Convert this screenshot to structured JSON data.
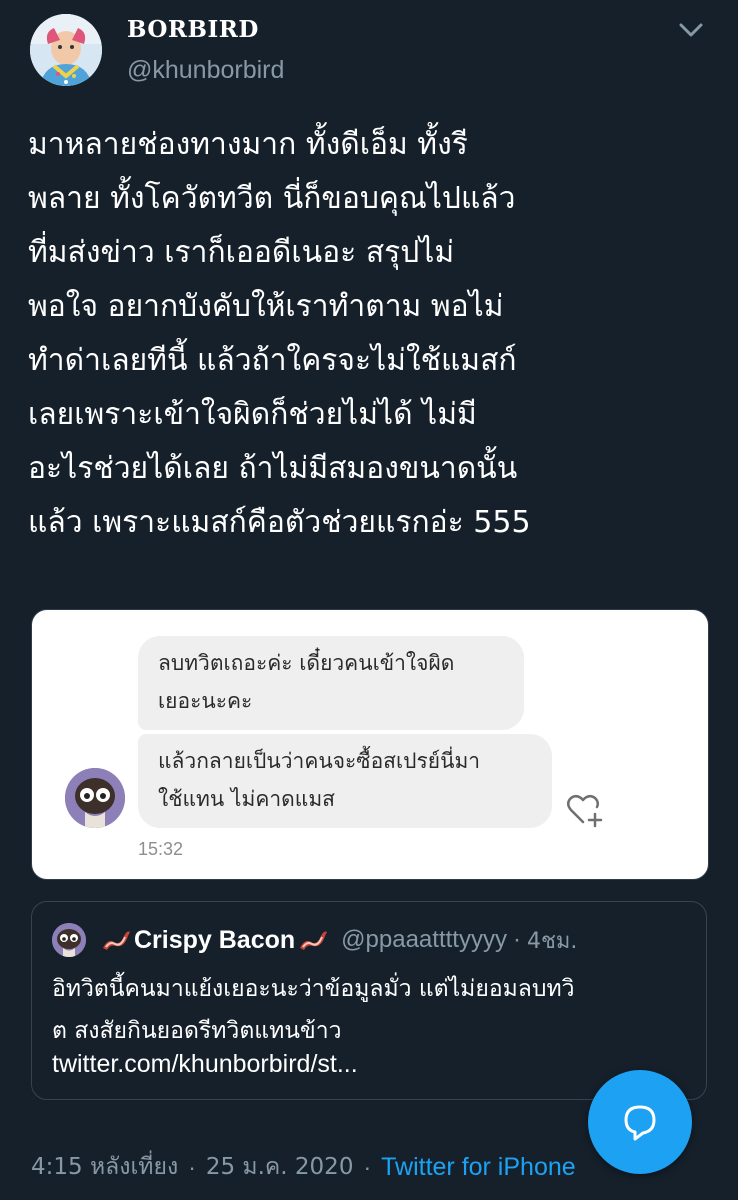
{
  "tweet": {
    "display_name": "BORBIRD",
    "username": "@khunborbird",
    "text": "มาหลายช่องทางมาก ทั้งดีเอ็ม ทั้งรี\nพลาย ทั้งโควัตทวีต นี่ก็ขอบคุณไปแล้ว\nที่มส่งข่าว เราก็เออดีเนอะ สรุปไม่\nพอใจ อยากบังคับให้เราทำตาม พอไม่\nทำด่าเลยทีนี้ แล้วถ้าใครจะไม่ใช้แมสก์\nเลยเพราะเข้าใจผิดก็ช่วยไม่ได้ ไม่มี\nอะไรช่วยได้เลย ถ้าไม่มีสมองขนาดนั้น\nแล้ว เพราะแมสก์คือตัวช่วยแรกอ่ะ 555",
    "timestamp": "4:15 หลังเที่ยง",
    "date": "25 ม.ค. 2020",
    "source": "Twitter for iPhone"
  },
  "media": {
    "bubble_1": "ลบทวิตเถอะค่ะ เดี๋ยวคนเข้าใจผิด\nเยอะนะคะ",
    "bubble_2": "แล้วกลายเป็นว่าคนจะซื้อสเปรย์นี่มา\nใช้แทน ไม่คาดแมส",
    "time": "15:32"
  },
  "quote": {
    "name": "Crispy Bacon",
    "handle": "@ppaaattttyyyy",
    "time": "4ชม.",
    "text": "อิทวิตนี้คนมาแย้งเยอะนะว่าข้อมูลมั่ว แต่ไม่ยอมลบทวิ\nต สงสัยกินยอดรีทวิตแทนข้าว",
    "link": "twitter.com/khunborbird/st..."
  },
  "icons": {
    "caret": "chevron-down-icon",
    "heart_add": "heart-plus-icon",
    "compose_reply": "reply-bubble-icon",
    "bacon": "bacon-emoji-icon"
  },
  "colors": {
    "background": "#15202b",
    "secondary_text": "#8899a6",
    "accent": "#1da1f2"
  }
}
